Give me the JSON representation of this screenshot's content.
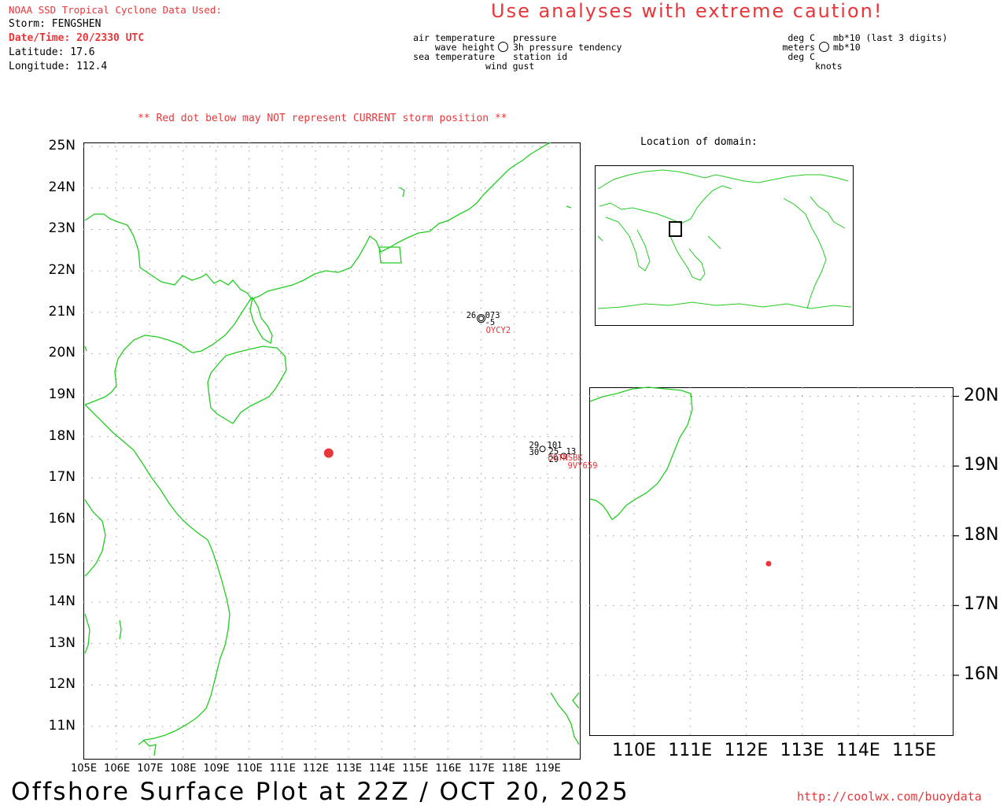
{
  "header": {
    "source": "NOAA SSD Tropical Cyclone Data Used:",
    "storm": "Storm: FENGSHEN",
    "datetime": "Date/Time: 20/2330 UTC",
    "latitude": "Latitude: 17.6",
    "longitude": "Longitude: 112.4",
    "caution": "Use analyses with extreme caution!"
  },
  "legend": {
    "left": [
      "air temperature",
      "wave height",
      "sea temperature"
    ],
    "right": [
      "pressure",
      "3h pressure tendency",
      "station id"
    ],
    "bottom": "wind gust",
    "units_left": [
      "deg C",
      "meters",
      "deg C"
    ],
    "units_right": [
      "mb*10 (last 3 digits)",
      "mb*10"
    ],
    "units_bottom": "knots"
  },
  "warning": "** Red dot below may NOT represent CURRENT storm position **",
  "inset_title": "Location of domain:",
  "main_map": {
    "lat_labels": [
      "25N",
      "24N",
      "23N",
      "22N",
      "21N",
      "20N",
      "19N",
      "18N",
      "17N",
      "16N",
      "15N",
      "14N",
      "13N",
      "12N",
      "11N"
    ],
    "lon_labels": [
      "105E",
      "106E",
      "107E",
      "108E",
      "109E",
      "110E",
      "111E",
      "112E",
      "113E",
      "114E",
      "115E",
      "116E",
      "117E",
      "118E",
      "119E"
    ],
    "storm_dot": {
      "lat": 17.6,
      "lon": 112.4,
      "color": "#e8363a"
    },
    "stations": [
      {
        "id": "OYCY2",
        "air_temp": "26",
        "pressure": "073",
        "tendency": "-5"
      },
      {
        "id": "DOTNSBK",
        "air_temp": "29",
        "pressure": "101",
        "sea_temp": "30",
        "wind_gust": "25",
        "tendency": "13"
      },
      {
        "id": "9VY659",
        "sea_temp": "29"
      }
    ]
  },
  "zoom_map": {
    "lat_labels": [
      "20N",
      "19N",
      "18N",
      "17N",
      "16N"
    ],
    "lon_labels": [
      "110E",
      "111E",
      "112E",
      "113E",
      "114E",
      "115E"
    ],
    "storm_dot": {
      "lat": 17.6,
      "lon": 112.4,
      "color": "#e8363a"
    }
  },
  "footer": {
    "title": "Offshore Surface Plot at 22Z / OCT 20, 2025",
    "url": "http://coolwx.com/buoydata"
  },
  "colors": {
    "coastline": "#22cc22",
    "accent": "#e8363a",
    "grid": "#999999"
  }
}
